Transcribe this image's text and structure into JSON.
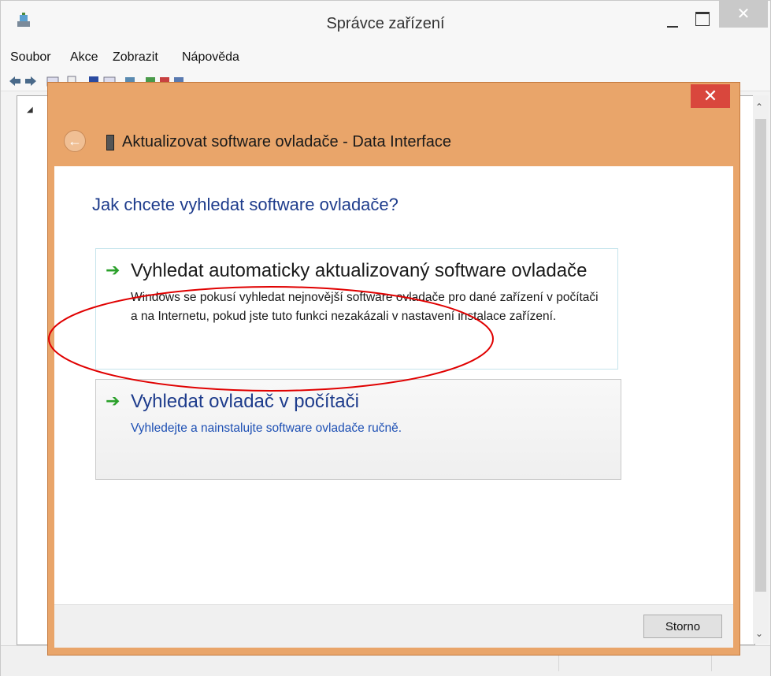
{
  "main_window": {
    "title": "Správce zařízení",
    "close_glyph": "✕",
    "menu": [
      "Soubor",
      "Akce",
      "Zobrazit",
      "Nápověda"
    ],
    "tree_expander": "◢",
    "scroll_up": "⌃",
    "scroll_down": "⌄"
  },
  "dialog": {
    "close_glyph": "✕",
    "back_glyph": "←",
    "title": "Aktualizovat software ovladače - Data Interface",
    "question": "Jak chcete vyhledat software ovladače?",
    "options": [
      {
        "arrow": "➔",
        "title": "Vyhledat automaticky aktualizovaný software ovladače",
        "description": "Windows se pokusí vyhledat nejnovější software ovladače pro dané zařízení v počítači a na Internetu, pokud jste tuto funkci nezakázali v nastavení instalace zařízení."
      },
      {
        "arrow": "➔",
        "title": "Vyhledat ovladač v počítači",
        "description": "Vyhledejte a nainstalujte software ovladače ručně."
      }
    ],
    "cancel_label": "Storno"
  },
  "colors": {
    "dialog_frame": "#e9a56a",
    "dialog_close": "#d9473d",
    "heading_blue": "#1e3c8c",
    "link_blue": "#1e50b4",
    "arrow_green": "#2aa02a",
    "annotation_red": "#e00000"
  }
}
